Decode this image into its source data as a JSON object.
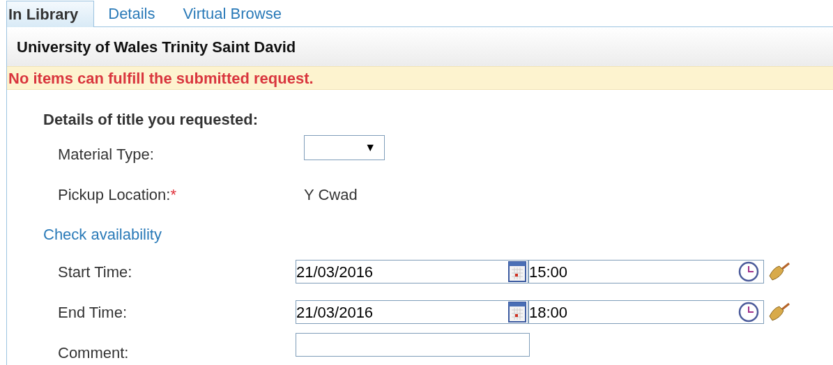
{
  "tabs": [
    {
      "label": "In Library",
      "selected": true
    },
    {
      "label": "Details",
      "selected": false
    },
    {
      "label": "Virtual Browse",
      "selected": false
    }
  ],
  "library_name": "University of Wales Trinity Saint David",
  "alert": "No items can fulfill the submitted request.",
  "section_title": "Details of title you requested:",
  "fields": [
    {
      "kind": "select",
      "label": "Material Type:",
      "arrow": "▼"
    },
    {
      "kind": "static",
      "label": "Pickup Location:",
      "required_mark": "*",
      "value": "Y Cwad"
    },
    {
      "kind": "link",
      "label": "Check availability"
    },
    {
      "kind": "datetime",
      "label": "Start Time:",
      "date": "21/03/2016",
      "time": "15:00"
    },
    {
      "kind": "datetime",
      "label": "End Time:",
      "date": "21/03/2016",
      "time": "18:00"
    },
    {
      "kind": "text",
      "label": "Comment:"
    }
  ]
}
